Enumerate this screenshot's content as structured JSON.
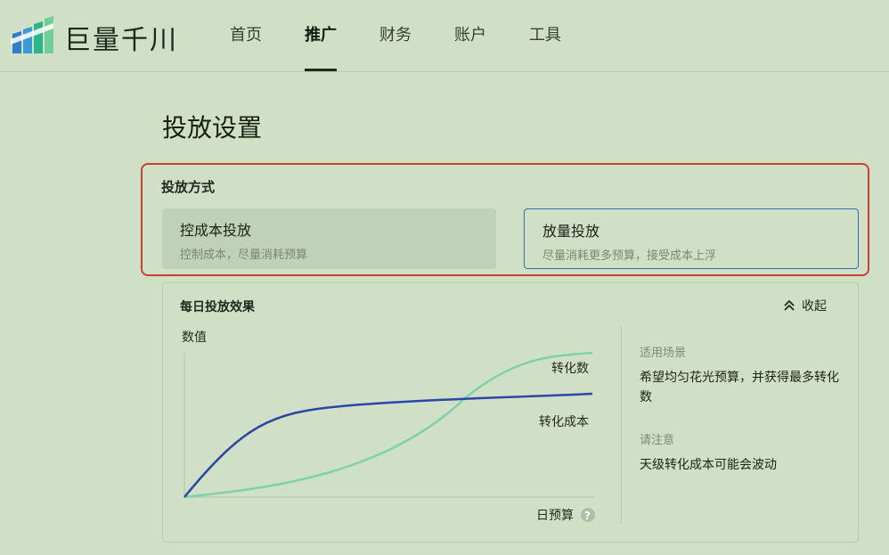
{
  "brand": "巨量千川",
  "nav": [
    "首页",
    "推广",
    "财务",
    "账户",
    "工具"
  ],
  "nav_active": 1,
  "page_title": "投放设置",
  "mode_section": {
    "label": "投放方式",
    "options": [
      {
        "title": "控成本投放",
        "desc": "控制成本，尽量消耗预算"
      },
      {
        "title": "放量投放",
        "desc": "尽量消耗更多预算，接受成本上浮"
      }
    ],
    "selected": 1
  },
  "effect_panel": {
    "title": "每日投放效果",
    "collapse_label": "收起",
    "scenario_label": "适用场景",
    "scenario_text": "希望均匀花光预算，并获得最多转化数",
    "note_label": "请注意",
    "note_text": "天级转化成本可能会波动"
  },
  "chart_data": {
    "type": "line",
    "ylabel": "数值",
    "xlabel": "日预算",
    "series": [
      {
        "name": "转化数",
        "color": "#7fd1ac"
      },
      {
        "name": "转化成本",
        "color": "#2a46a6"
      }
    ]
  },
  "colors": {
    "background": "#cfe0c6",
    "highlight": "#c8422d",
    "selected_border": "#3d6aa8"
  }
}
